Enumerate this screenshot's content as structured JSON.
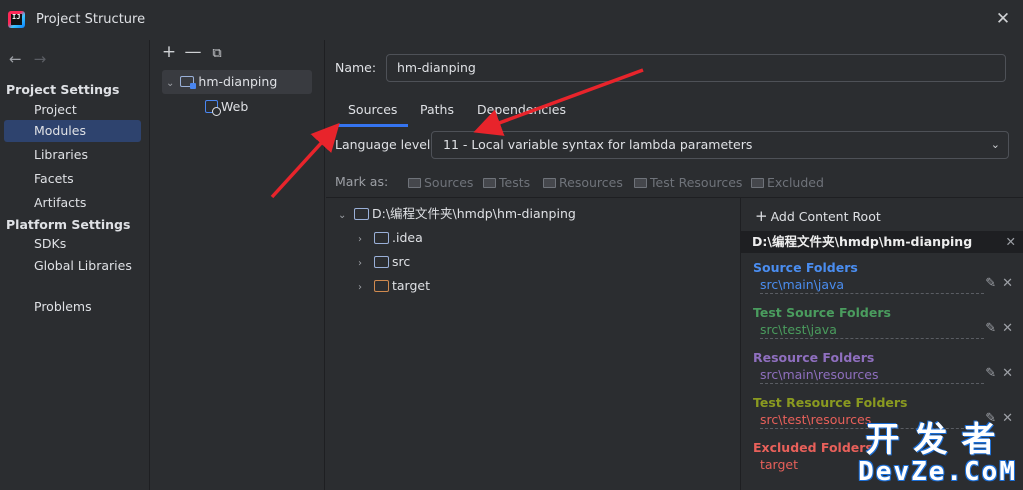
{
  "window": {
    "title": "Project Structure",
    "close": "✕"
  },
  "nav": {
    "back": "←",
    "forward": "→"
  },
  "sidebar": {
    "project_settings_heading": "Project Settings",
    "project_items": [
      "Project",
      "Modules",
      "Libraries",
      "Facets",
      "Artifacts"
    ],
    "platform_settings_heading": "Platform Settings",
    "platform_items": [
      "SDKs",
      "Global Libraries"
    ],
    "problems": "Problems",
    "selected": "Modules"
  },
  "module_tree": {
    "toolbar": [
      "+",
      "—",
      "⧉"
    ],
    "module_name": "hm-dianping",
    "facet": "Web"
  },
  "module": {
    "name_label": "Name:",
    "name_value": "hm-dianping",
    "tabs": [
      "Sources",
      "Paths",
      "Dependencies"
    ],
    "active_tab": "Sources",
    "language_level_label": "Language level:",
    "language_level_value": "11 - Local variable syntax for lambda parameters",
    "mark_as_label": "Mark as:",
    "mark_as_options": [
      "Sources",
      "Tests",
      "Resources",
      "Test Resources",
      "Excluded"
    ]
  },
  "content_tree": {
    "root": "D:\\编程文件夹\\hmdp\\hm-dianping",
    "children": [
      ".idea",
      "src",
      "target"
    ]
  },
  "content_roots": {
    "add_label": "Add Content Root",
    "root_path": "D:\\编程文件夹\\hmdp\\hm-dianping",
    "groups": [
      {
        "heading": "Source Folders",
        "path": "src\\main\\java",
        "color": "#4a8df0"
      },
      {
        "heading": "Test Source Folders",
        "path": "src\\test\\java",
        "color": "#4a9c5e"
      },
      {
        "heading": "Resource Folders",
        "path": "src\\main\\resources",
        "color": "#8f6fbf"
      },
      {
        "heading": "Test Resource Folders",
        "path": "src\\test\\resources",
        "color": "#8a9a20"
      },
      {
        "heading": "Excluded Folders",
        "path": "target",
        "color": "#e8605a"
      }
    ]
  },
  "watermark": {
    "line1": "开发者",
    "line2": "DevZe.CoM"
  },
  "colors": {
    "accent": "#3574f0",
    "selection": "#2e436e",
    "annotation_arrow": "#e8242b"
  }
}
